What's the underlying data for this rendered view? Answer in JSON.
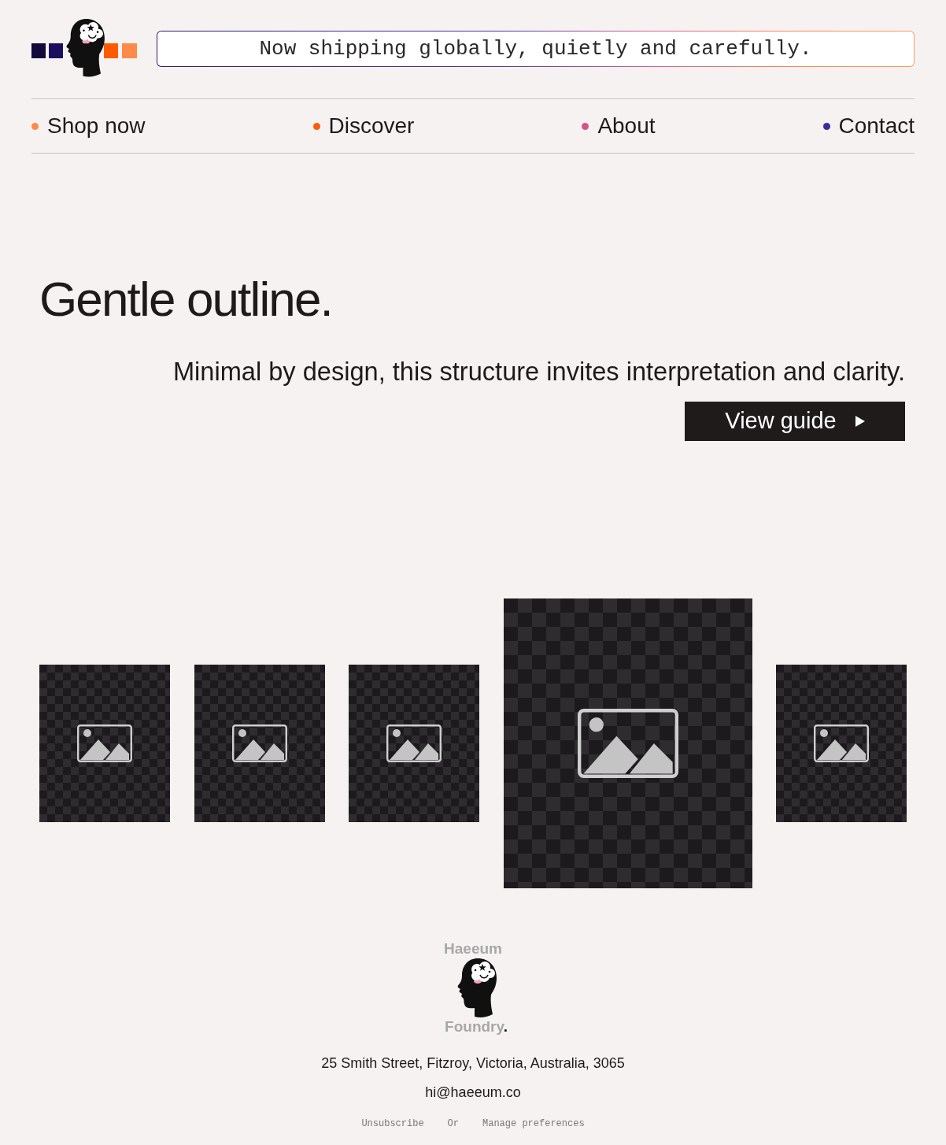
{
  "header": {
    "banner": "Now shipping globally, quietly and carefully."
  },
  "nav": [
    {
      "label": "Shop now",
      "color": "#ff8a4c"
    },
    {
      "label": "Discover",
      "color": "#ff5a0a"
    },
    {
      "label": "About",
      "color": "#d2548a"
    },
    {
      "label": "Contact",
      "color": "#3b2c9e"
    }
  ],
  "hero": {
    "title": "Gentle outline.",
    "subtitle": "Minimal by design, this structure invites interpretation and clarity.",
    "button": {
      "label": "View guide"
    }
  },
  "gallery": [
    {
      "selected": false
    },
    {
      "selected": false
    },
    {
      "selected": false
    },
    {
      "selected": true
    },
    {
      "selected": false
    }
  ],
  "footer": {
    "logo": {
      "top": "Haeeum",
      "bottom": "Foundry",
      "mark": "."
    },
    "address": "25 Smith Street, Fitzroy, Victoria, Australia, 3065",
    "email": "hi@haeeum.co",
    "links": [
      "Unsubscribe",
      "Manage preferences"
    ],
    "separator": "Or"
  }
}
